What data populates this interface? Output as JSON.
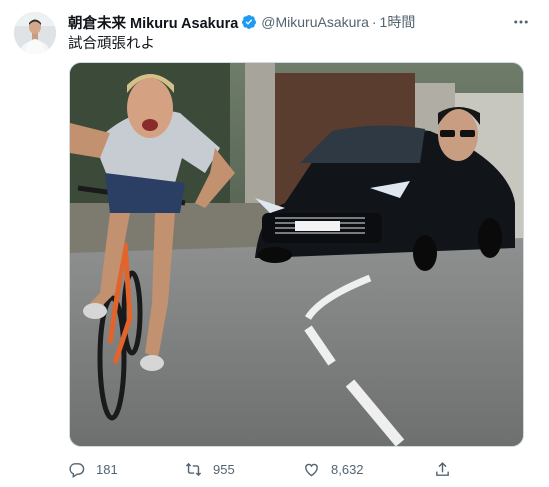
{
  "tweet": {
    "author": {
      "display_name": "朝倉未来 Mikuru Asakura",
      "handle": "@MikuruAsakura",
      "verified": true,
      "avatar_icon": "user-avatar"
    },
    "separator": "·",
    "time": "1時間",
    "text": "試合頑張れよ",
    "media": {
      "icon": "photo-cyclist-followed-by-car"
    },
    "actions": {
      "reply": {
        "icon": "reply-icon",
        "count": "181"
      },
      "retweet": {
        "icon": "retweet-icon",
        "count": "955"
      },
      "like": {
        "icon": "heart-icon",
        "count": "8,632"
      },
      "share": {
        "icon": "share-icon"
      }
    }
  },
  "colors": {
    "text_primary": "#0f1419",
    "text_secondary": "#536471",
    "verified_blue": "#1d9bf0",
    "border": "#cfd9de"
  }
}
